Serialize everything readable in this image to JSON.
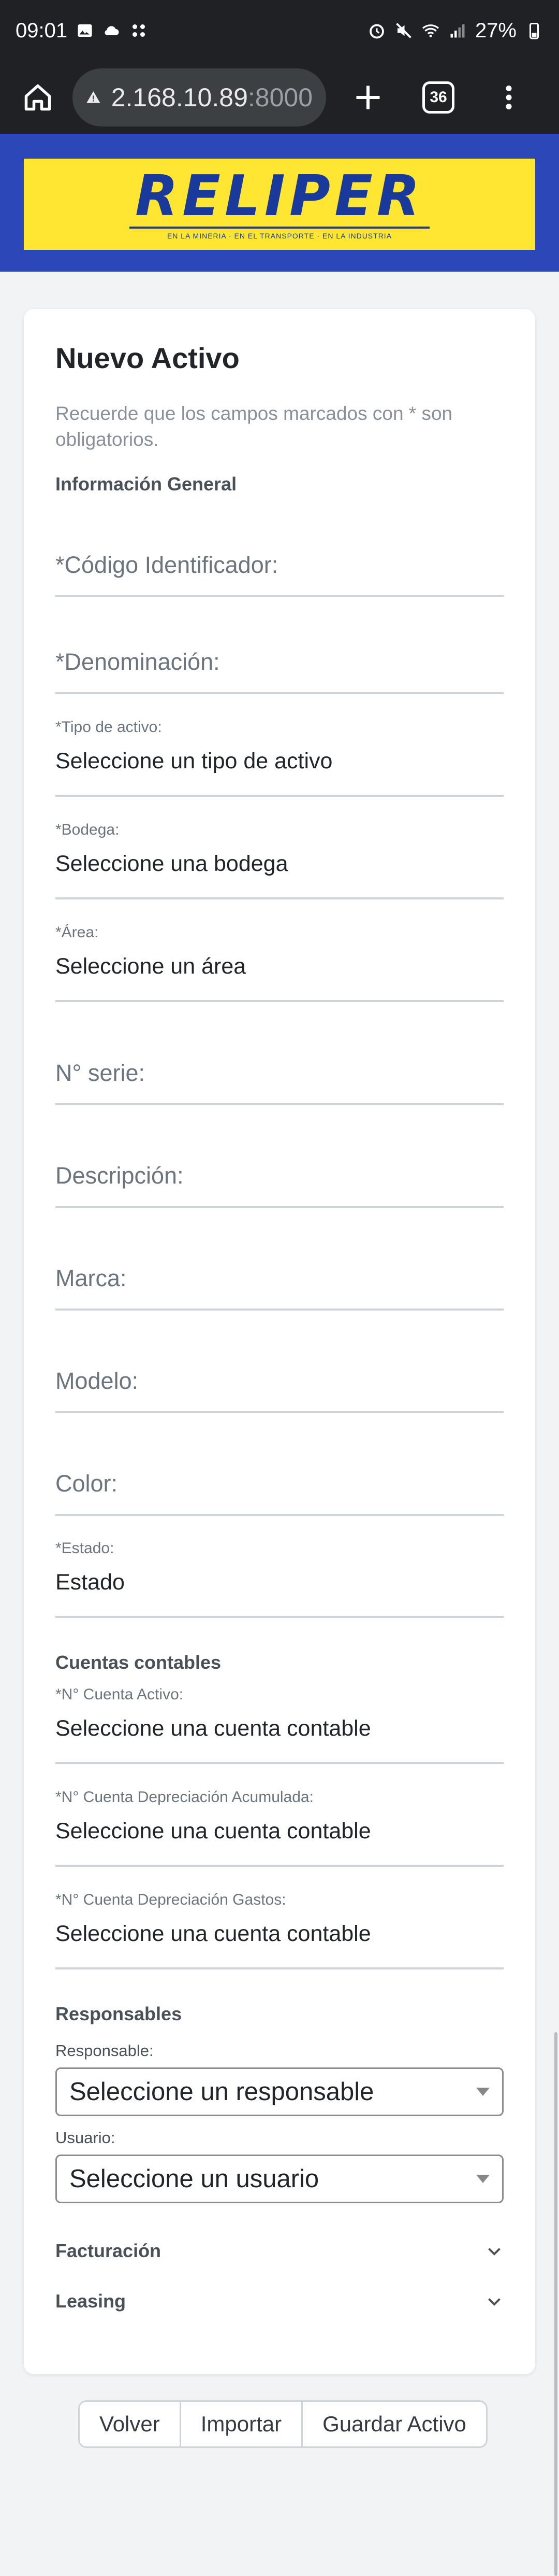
{
  "statusbar": {
    "time": "09:01",
    "battery": "27%"
  },
  "browser": {
    "url_host": "2.168.10.89",
    "url_port": ":8000",
    "tab_count": "36"
  },
  "brand": {
    "logo": "RELIPER",
    "tagline": "EN LA MINERIA · EN EL TRANSPORTE · EN LA INDUSTRIA"
  },
  "form": {
    "title": "Nuevo Activo",
    "note": "Recuerde que los campos marcados con * son obligatorios.",
    "general_section": "Información General",
    "codigo_placeholder": "*Código Identificador:",
    "denominacion_placeholder": "*Denominación:",
    "tipo_label": "*Tipo de activo:",
    "tipo_value": "Seleccione un tipo de activo",
    "bodega_label": "*Bodega:",
    "bodega_value": "Seleccione una bodega",
    "area_label": "*Área:",
    "area_value": "Seleccione un área",
    "serie_placeholder": "N° serie:",
    "descripcion_placeholder": "Descripción:",
    "marca_placeholder": "Marca:",
    "modelo_placeholder": "Modelo:",
    "color_placeholder": "Color:",
    "estado_label": "*Estado:",
    "estado_value": "Estado",
    "cuentas_section": "Cuentas contables",
    "cuenta_activo_label": "*N° Cuenta Activo:",
    "cuenta_activo_value": "Seleccione una cuenta contable",
    "cuenta_dep_acum_label": "*N° Cuenta Depreciación Acumulada:",
    "cuenta_dep_acum_value": "Seleccione una cuenta contable",
    "cuenta_dep_gastos_label": "*N° Cuenta Depreciación Gastos:",
    "cuenta_dep_gastos_value": "Seleccione una cuenta contable",
    "responsables_section": "Responsables",
    "responsable_label": "Responsable:",
    "responsable_value": "Seleccione un responsable",
    "usuario_label": "Usuario:",
    "usuario_value": "Seleccione un usuario",
    "facturacion_label": "Facturación",
    "leasing_label": "Leasing"
  },
  "actions": {
    "back": "Volver",
    "import": "Importar",
    "save": "Guardar Activo"
  }
}
